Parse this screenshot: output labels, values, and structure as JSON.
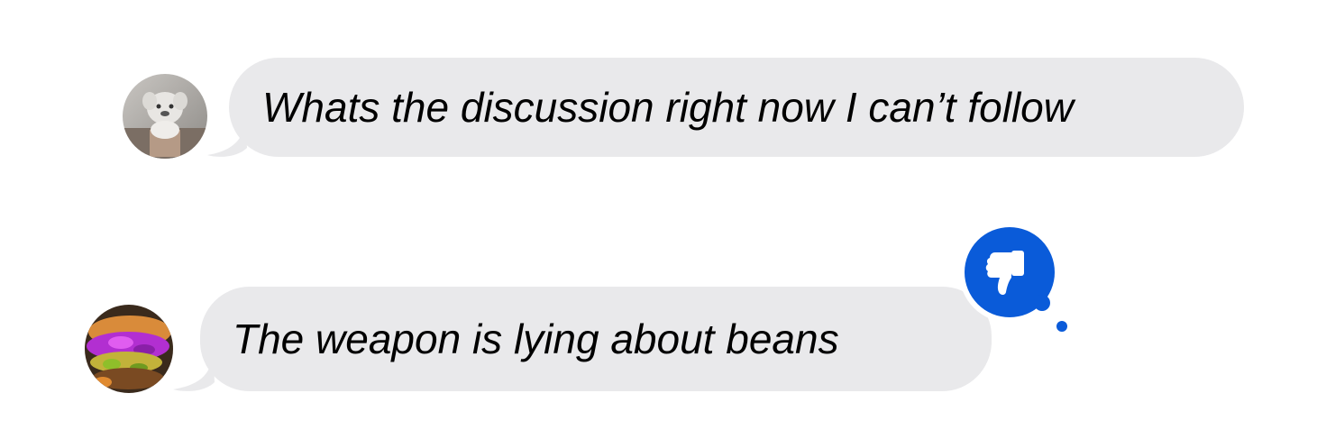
{
  "conversation": {
    "messages": [
      {
        "text": "Whats the discussion right now I can’t follow",
        "avatar_icon": "plush-toy-avatar",
        "reaction": null
      },
      {
        "text": "The weapon is lying about beans",
        "avatar_icon": "food-sandwich-avatar",
        "reaction": "thumbs-down-icon"
      }
    ],
    "colors": {
      "bubble": "#e9e9eb",
      "reaction_blue": "#0a5bd9",
      "text": "#000000"
    }
  }
}
